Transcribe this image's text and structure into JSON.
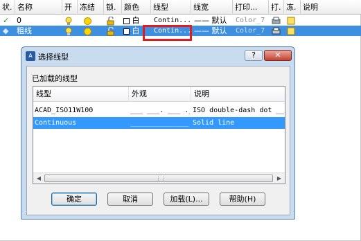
{
  "layer_header": [
    "状.",
    "名称",
    "开",
    "冻结",
    "锁.",
    "颜色",
    "线型",
    "线宽",
    "打印...",
    "打.",
    "冻.",
    "说明"
  ],
  "layers": [
    {
      "status": "✓",
      "name": "0",
      "color": "白",
      "linetype": "Contin...",
      "lineweight": "—— 默认",
      "plot_style": "Color_7"
    },
    {
      "status": "◆",
      "name": "粗线",
      "color": "白",
      "linetype": "Contin...",
      "lineweight": "—— 默认",
      "plot_style": "Color_7"
    }
  ],
  "dialog": {
    "title": "选择线型",
    "help_button": "?",
    "close_button": "✕",
    "loaded_label": "已加载的线型",
    "columns": [
      "线型",
      "外观",
      "说明"
    ],
    "rows": [
      {
        "name": "ACAD_ISO11W100",
        "appearance": "___ ___. ___ .___ ._",
        "description": "ISO double-dash dot __ __ ."
      },
      {
        "name": "Continuous",
        "appearance": "______________",
        "description": "Solid line"
      }
    ],
    "buttons": {
      "ok": "确定",
      "cancel": "取消",
      "load": "加载(L)...",
      "help": "帮助(H)"
    }
  },
  "colors": {
    "selection": "#3399ff",
    "highlight_box": "#e01c1c",
    "dialog_frame": "#c9dbef"
  }
}
